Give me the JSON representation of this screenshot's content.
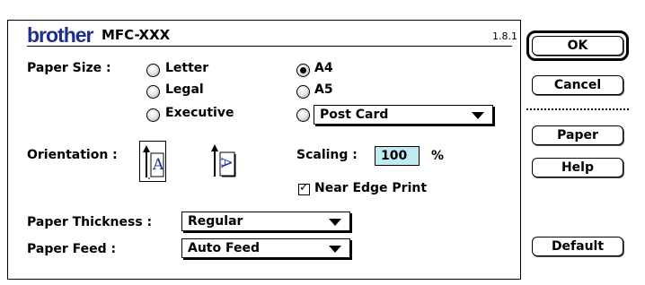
{
  "header": {
    "brand": "brother",
    "model": "MFC-XXX",
    "version": "1.8.1"
  },
  "paper_size": {
    "label": "Paper Size :",
    "options": [
      {
        "label": "Letter",
        "selected": false
      },
      {
        "label": "Legal",
        "selected": false
      },
      {
        "label": "Executive",
        "selected": false
      },
      {
        "label": "A4",
        "selected": true
      },
      {
        "label": "A5",
        "selected": false
      }
    ],
    "custom_select_value": "Post Card",
    "custom_selected": false
  },
  "orientation": {
    "label": "Orientation :",
    "portrait_glyph": "A",
    "landscape_glyph": "A"
  },
  "scaling": {
    "label": "Scaling :",
    "value": "100",
    "unit": "%"
  },
  "near_edge": {
    "label": "Near Edge Print",
    "checked": true,
    "mark": "✓"
  },
  "paper_thickness": {
    "label": "Paper Thickness :",
    "value": "Regular"
  },
  "paper_feed": {
    "label": "Paper Feed :",
    "value": "Auto Feed"
  },
  "buttons": {
    "ok": "OK",
    "cancel": "Cancel",
    "paper": "Paper",
    "help": "Help",
    "default": "Default"
  },
  "colors": {
    "brand": "#1d2f8a",
    "scaling_field": "#bfeaf2",
    "landscape_glyph": "#1a2fbf"
  }
}
